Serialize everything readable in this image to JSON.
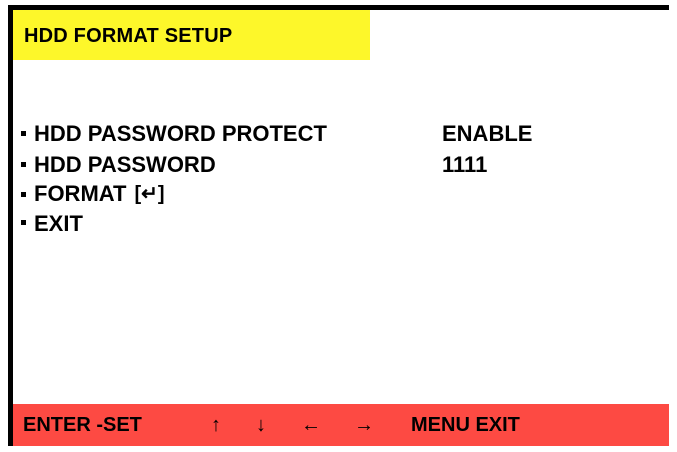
{
  "title": "HDD FORMAT SETUP",
  "menu": {
    "items": [
      {
        "label": "HDD PASSWORD PROTECT",
        "value": "ENABLE"
      },
      {
        "label": "HDD PASSWORD",
        "value": "1111"
      },
      {
        "label": "FORMAT",
        "enter_symbol": "[↵]"
      },
      {
        "label": "EXIT"
      }
    ]
  },
  "footer": {
    "enter_set": "ENTER -SET",
    "up": "↑",
    "down": "↓",
    "left": "←",
    "right": "→",
    "menu_exit": "MENU EXIT"
  },
  "colors": {
    "title_bar": "#fdf72a",
    "footer_bar": "#fd4a43",
    "border": "#000000",
    "background": "#ffffff"
  }
}
